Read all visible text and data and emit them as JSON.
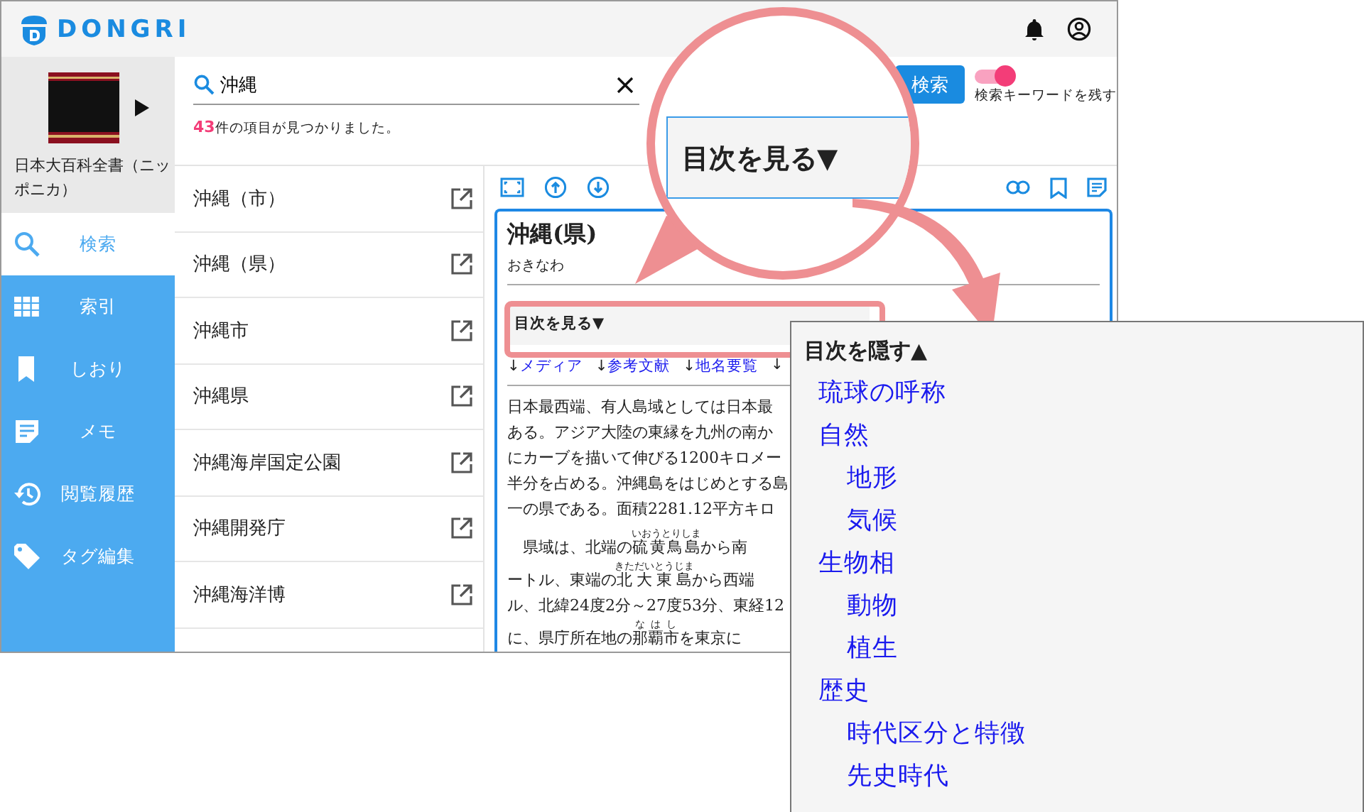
{
  "app": {
    "logo": "DONGRI"
  },
  "book": {
    "title": "日本大百科全書（ニッポニカ）"
  },
  "sidebar": {
    "items": [
      {
        "label": "検索",
        "kind": "search",
        "selected": true
      },
      {
        "label": "索引",
        "kind": "index",
        "selected": false
      },
      {
        "label": "しおり",
        "kind": "bookmarks",
        "selected": false
      },
      {
        "label": "メモ",
        "kind": "memo",
        "selected": false
      },
      {
        "label": "閲覧履歴",
        "kind": "history",
        "selected": false
      },
      {
        "label": "タグ編集",
        "kind": "tags",
        "selected": false
      }
    ]
  },
  "search": {
    "value": "沖縄",
    "button": "検索",
    "keep_keyword": {
      "label": "検索キーワードを残す",
      "on": true
    },
    "result_count": "43",
    "result_text": "件の項目が見つかりました。"
  },
  "results": [
    {
      "title": "沖縄（市）"
    },
    {
      "title": "沖縄（県）"
    },
    {
      "title": "沖縄市"
    },
    {
      "title": "沖縄県"
    },
    {
      "title": "沖縄海岸国定公園"
    },
    {
      "title": "沖縄開発庁"
    },
    {
      "title": "沖縄海洋博"
    }
  ],
  "article": {
    "title": "沖縄(県)",
    "reading": "おきなわ",
    "toc_toggle": "目次を見る▼",
    "links": [
      {
        "arrow": "↓",
        "label": "メディア"
      },
      {
        "arrow": "↓",
        "label": "参考文献"
      },
      {
        "arrow": "↓",
        "label": "地名要覧"
      },
      {
        "arrow": "↓"
      }
    ],
    "paragraphs": [
      [
        [
          {
            "text": "日本最西端、有人島域としては日本最"
          }
        ],
        [
          {
            "text": "ある。アジア大陸の東縁を九州の南か"
          }
        ],
        [
          {
            "text": "にカーブを描いて伸びる1200キロメー"
          }
        ],
        [
          {
            "text": "半分を占める。沖縄島をはじめとする島"
          }
        ],
        [
          {
            "text": "一の県である。面積2281.12平方キロ"
          }
        ]
      ],
      [
        [
          {
            "text": "県域は、北端の"
          },
          {
            "text": "硫黄鳥島",
            "ruby": "いおうとりしま"
          },
          {
            "text": "から南"
          }
        ],
        [
          {
            "text": "ートル、東端の"
          },
          {
            "text": "北大東島",
            "ruby": "きただいとうじま"
          },
          {
            "text": "から西端"
          }
        ],
        [
          {
            "text": "ル、北緯24度2分～27度53分、東経12"
          }
        ],
        [
          {
            "text": "に、県庁所在地の"
          },
          {
            "text": "那覇市",
            "ruby": "なはし"
          },
          {
            "text": "を東京に"
          }
        ]
      ]
    ]
  },
  "magnifier": {
    "label": "目次を見る▼"
  },
  "toc": {
    "toggle": "目次を隠す▲",
    "items": [
      {
        "label": "琉球の呼称"
      },
      {
        "label": "自然",
        "children": [
          {
            "label": "地形"
          },
          {
            "label": "気候"
          }
        ]
      },
      {
        "label": "生物相",
        "children": [
          {
            "label": "動物"
          },
          {
            "label": "植生"
          }
        ]
      },
      {
        "label": "歴史",
        "children": [
          {
            "label": "時代区分と特徴"
          },
          {
            "label": "先史時代"
          }
        ]
      }
    ]
  }
}
